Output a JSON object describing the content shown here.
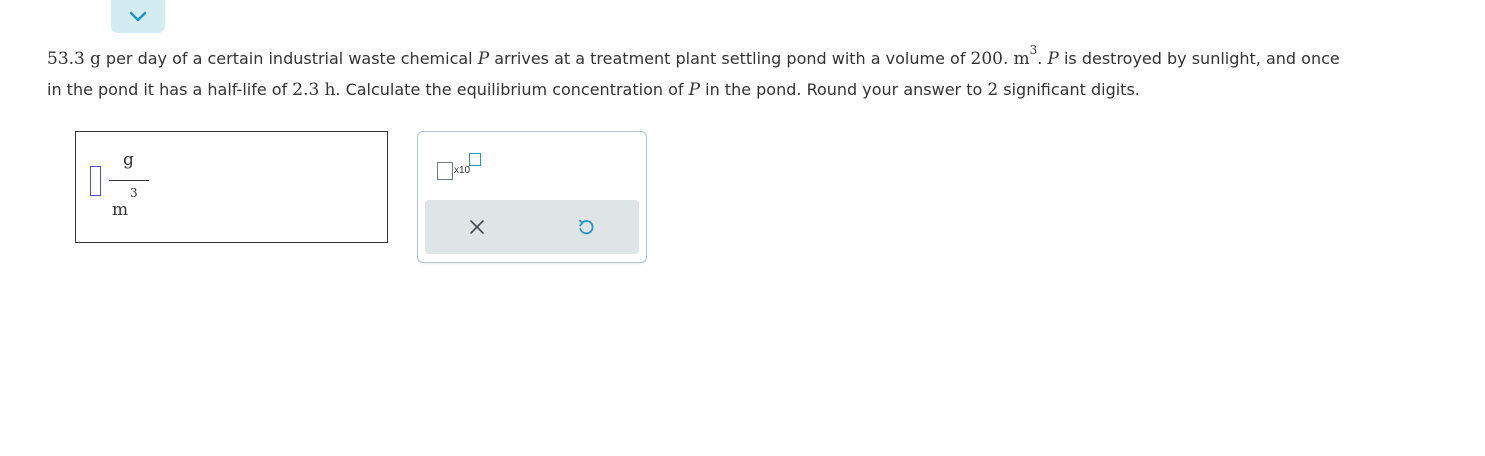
{
  "nav": {
    "collapse_icon": "chevron-down-icon"
  },
  "question": {
    "mass_value": "53.3",
    "mass_unit": "g",
    "text_1": " per day of a certain industrial waste chemical ",
    "var_p": "P",
    "text_2": " arrives at a treatment plant settling pond with a volume of ",
    "volume_value": "200.",
    "volume_unit": "m",
    "volume_exp": "3",
    "text_3": ". ",
    "text_4": " is destroyed by sunlight, and once",
    "text_5": "in the pond it has a half-life of ",
    "halflife_value": "2.3",
    "halflife_unit": "h",
    "text_6": ". Calculate the equilibrium concentration of ",
    "text_7": " in the pond. Round your answer to ",
    "sig_digits": "2",
    "text_8": " significant digits."
  },
  "answer": {
    "value": "",
    "unit_numerator": "g",
    "unit_denominator": "m",
    "unit_denominator_exp": "3"
  },
  "tools": {
    "x10_label": "x10",
    "clear_icon": "close-icon",
    "undo_icon": "undo-icon"
  },
  "colors": {
    "accent_tab": "#d3ecf2",
    "chevron": "#2596be",
    "input_border": "#4a52c8",
    "action_bar": "#dfe5e7",
    "undo": "#2596be"
  }
}
